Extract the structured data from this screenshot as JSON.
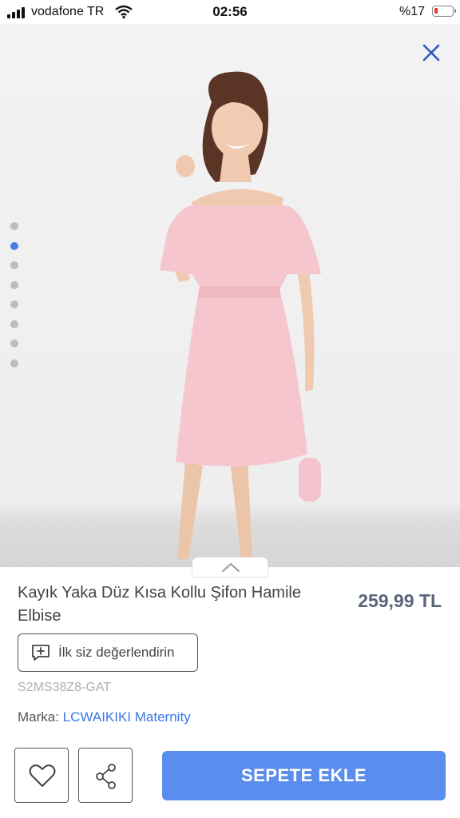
{
  "status_bar": {
    "carrier": "vodafone TR",
    "time": "02:56",
    "battery": "%17",
    "battery_level": 0.17
  },
  "gallery": {
    "image_count": 8,
    "active_index": 1,
    "close_icon": "close-icon",
    "expand_icon": "chevron-up-icon"
  },
  "product": {
    "title": "Kayık Yaka Düz Kısa Kollu Şifon Hamile Elbise",
    "price": "259,99 TL",
    "rate_label": "İlk siz değerlendirin",
    "sku": "S2MS38Z8-GAT",
    "brand_label": "Marka:",
    "brand_name": "LCWAIKIKI Maternity"
  },
  "actions": {
    "add_to_cart": "SEPETE EKLE",
    "favorite_icon": "heart-icon",
    "share_icon": "share-icon"
  },
  "colors": {
    "accent": "#5b8dee",
    "link": "#3b78e7",
    "price": "#5a6479",
    "active_dot": "#4a7de8",
    "dress": "#f6c6cf"
  }
}
